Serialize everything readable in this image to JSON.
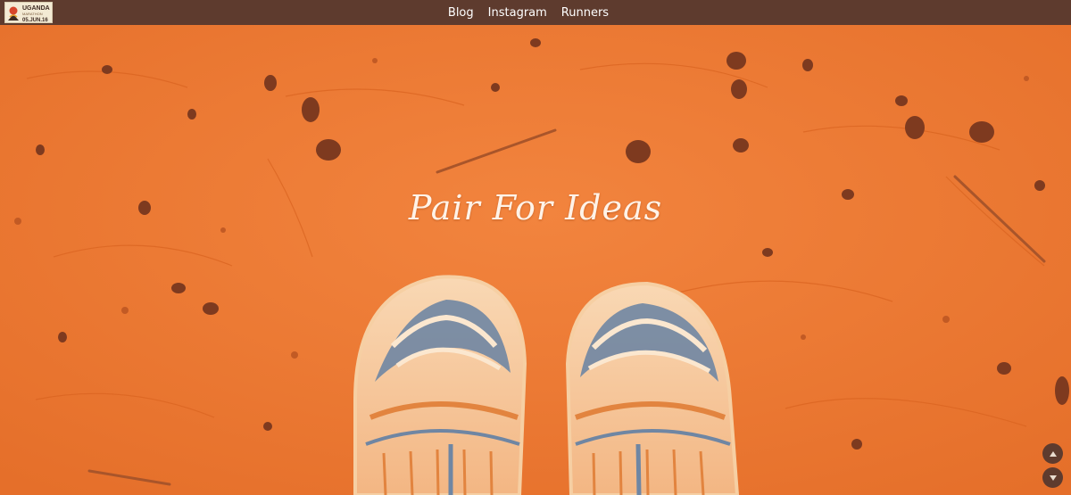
{
  "logo": {
    "line1": "UGANDA",
    "line2": "MARATHON",
    "date": "05.JUN.16"
  },
  "nav": {
    "items": [
      {
        "label": "Blog"
      },
      {
        "label": "Instagram"
      },
      {
        "label": "Runners"
      }
    ]
  },
  "hero": {
    "title": "Pair For Ideas"
  },
  "colors": {
    "topbar": "#5e3b2e",
    "ground": "#ee7a34",
    "title": "#fff3e8",
    "shoe_blue": "#6f86a3"
  },
  "icons": {
    "scroll_up": "triangle-up-icon",
    "scroll_down": "triangle-down-icon"
  }
}
